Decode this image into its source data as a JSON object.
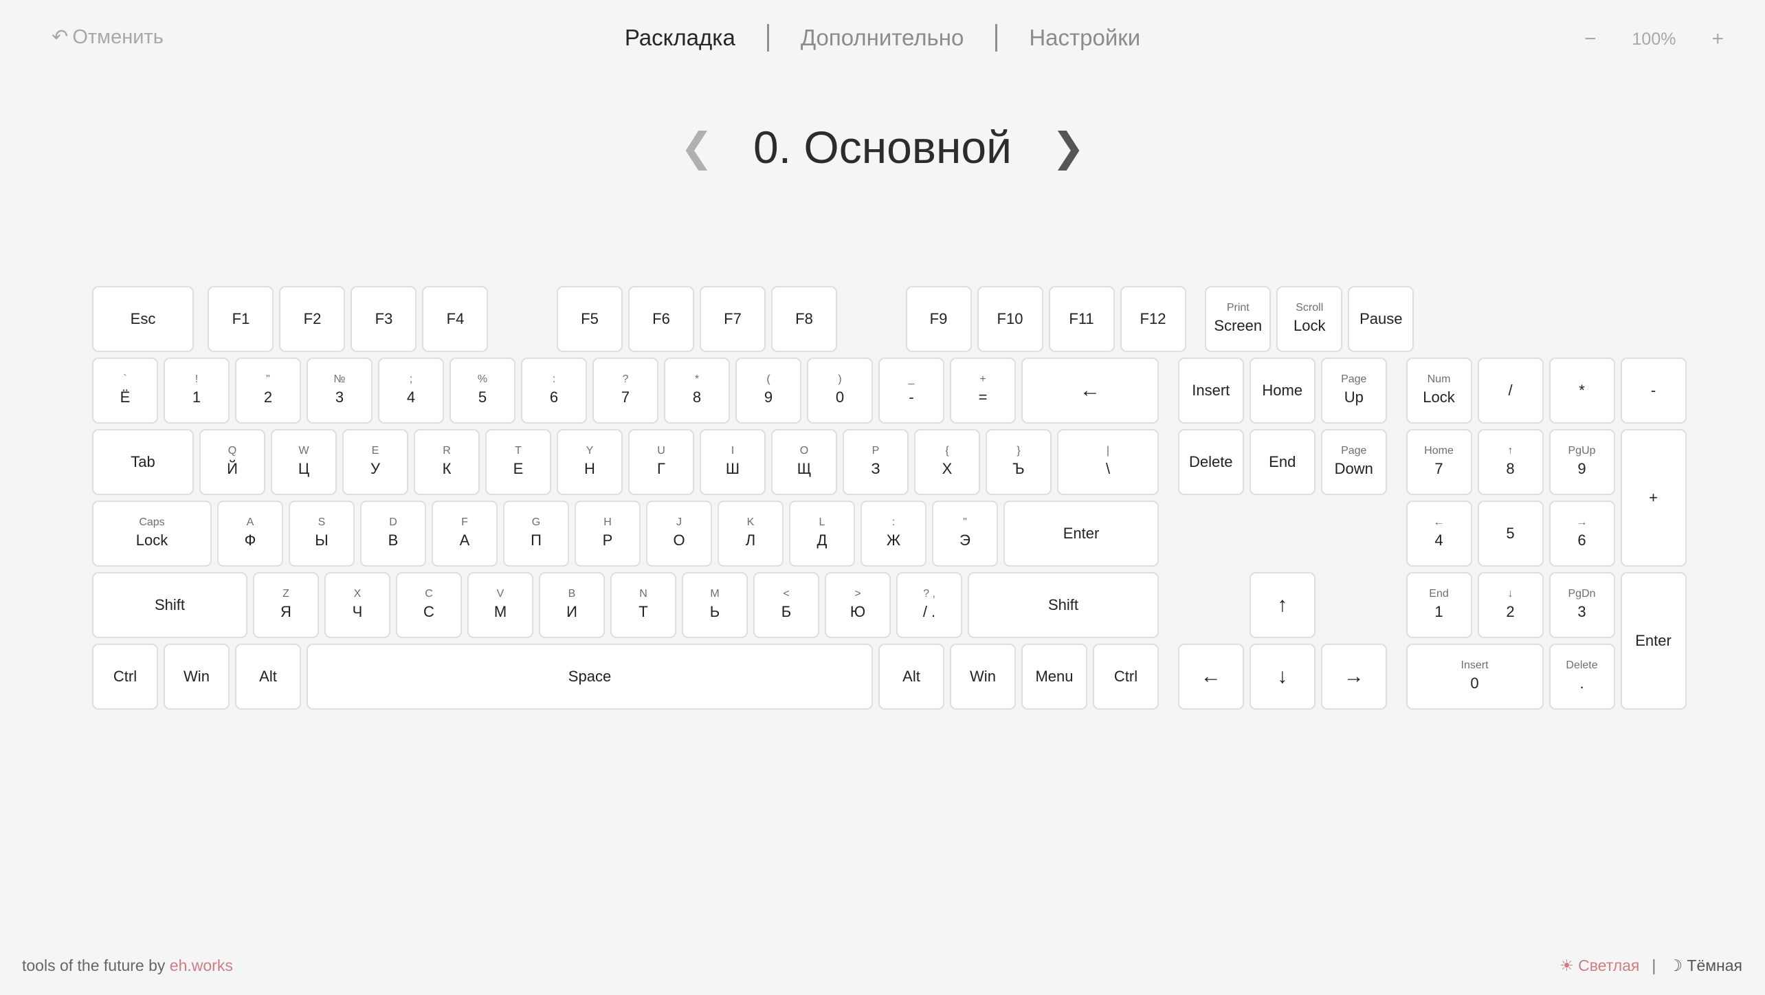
{
  "header": {
    "undo_label": "Отменить",
    "undo_icon": "undo-arrow-icon",
    "tabs": [
      "Раскладка",
      "Дополнительно",
      "Настройки"
    ],
    "active_tab": "Раскладка",
    "zoom": {
      "minus": "−",
      "value": "100%",
      "plus": "+"
    }
  },
  "layer": {
    "title": "0. Основной",
    "prev": "❮",
    "next": "❯"
  },
  "keys": {
    "esc": {
      "sec": "",
      "pri": "Esc"
    },
    "f1": {
      "sec": "",
      "pri": "F1"
    },
    "f2": {
      "sec": "",
      "pri": "F2"
    },
    "f3": {
      "sec": "",
      "pri": "F3"
    },
    "f4": {
      "sec": "",
      "pri": "F4"
    },
    "f5": {
      "sec": "",
      "pri": "F5"
    },
    "f6": {
      "sec": "",
      "pri": "F6"
    },
    "f7": {
      "sec": "",
      "pri": "F7"
    },
    "f8": {
      "sec": "",
      "pri": "F8"
    },
    "f9": {
      "sec": "",
      "pri": "F9"
    },
    "f10": {
      "sec": "",
      "pri": "F10"
    },
    "f11": {
      "sec": "",
      "pri": "F11"
    },
    "f12": {
      "sec": "",
      "pri": "F12"
    },
    "printscreen": {
      "sec": "Print",
      "pri": "Screen"
    },
    "scrolllock": {
      "sec": "Scroll",
      "pri": "Lock"
    },
    "pause": {
      "sec": "",
      "pri": "Pause"
    },
    "grave": {
      "sec": "`",
      "pri": "Ё"
    },
    "d1": {
      "sec": "!",
      "pri": "1"
    },
    "d2": {
      "sec": "\"",
      "pri": "2"
    },
    "d3": {
      "sec": "№",
      "pri": "3"
    },
    "d4": {
      "sec": ";",
      "pri": "4"
    },
    "d5": {
      "sec": "%",
      "pri": "5"
    },
    "d6": {
      "sec": ":",
      "pri": "6"
    },
    "d7": {
      "sec": "?",
      "pri": "7"
    },
    "d8": {
      "sec": "*",
      "pri": "8"
    },
    "d9": {
      "sec": "(",
      "pri": "9"
    },
    "d0": {
      "sec": ")",
      "pri": "0"
    },
    "minus": {
      "sec": "_",
      "pri": "-"
    },
    "equal": {
      "sec": "+",
      "pri": "="
    },
    "backspace": {
      "sec": "",
      "pri": "←"
    },
    "insert": {
      "sec": "",
      "pri": "Insert"
    },
    "home": {
      "sec": "",
      "pri": "Home"
    },
    "pageup": {
      "sec": "Page",
      "pri": "Up"
    },
    "numlock": {
      "sec": "Num",
      "pri": "Lock"
    },
    "kpslash": {
      "sec": "",
      "pri": "/"
    },
    "kpstar": {
      "sec": "",
      "pri": "*"
    },
    "kpminus": {
      "sec": "",
      "pri": "-"
    },
    "tab": {
      "sec": "",
      "pri": "Tab"
    },
    "q": {
      "sec": "Q",
      "pri": "Й"
    },
    "w": {
      "sec": "W",
      "pri": "Ц"
    },
    "e": {
      "sec": "E",
      "pri": "У"
    },
    "r": {
      "sec": "R",
      "pri": "К"
    },
    "t": {
      "sec": "T",
      "pri": "Е"
    },
    "y": {
      "sec": "Y",
      "pri": "Н"
    },
    "u": {
      "sec": "U",
      "pri": "Г"
    },
    "i": {
      "sec": "I",
      "pri": "Ш"
    },
    "o": {
      "sec": "O",
      "pri": "Щ"
    },
    "p": {
      "sec": "P",
      "pri": "З"
    },
    "lbracket": {
      "sec": "{",
      "pri": "Х"
    },
    "rbracket": {
      "sec": "}",
      "pri": "Ъ"
    },
    "backslash": {
      "sec": "|",
      "pri": "\\"
    },
    "delete": {
      "sec": "",
      "pri": "Delete"
    },
    "end": {
      "sec": "",
      "pri": "End"
    },
    "pagedown": {
      "sec": "Page",
      "pri": "Down"
    },
    "kp7": {
      "sec": "Home",
      "pri": "7"
    },
    "kp8": {
      "sec": "↑",
      "pri": "8"
    },
    "kp9": {
      "sec": "PgUp",
      "pri": "9"
    },
    "kpplus": {
      "sec": "",
      "pri": "+"
    },
    "capslock": {
      "sec": "Caps",
      "pri": "Lock"
    },
    "a": {
      "sec": "A",
      "pri": "Ф"
    },
    "s": {
      "sec": "S",
      "pri": "Ы"
    },
    "d": {
      "sec": "D",
      "pri": "В"
    },
    "f": {
      "sec": "F",
      "pri": "А"
    },
    "g": {
      "sec": "G",
      "pri": "П"
    },
    "h": {
      "sec": "H",
      "pri": "Р"
    },
    "j": {
      "sec": "J",
      "pri": "О"
    },
    "k": {
      "sec": "K",
      "pri": "Л"
    },
    "l": {
      "sec": "L",
      "pri": "Д"
    },
    "semicolon": {
      "sec": ":",
      "pri": "Ж"
    },
    "quote": {
      "sec": "\"",
      "pri": "Э"
    },
    "enter": {
      "sec": "",
      "pri": "Enter"
    },
    "kp4": {
      "sec": "←",
      "pri": "4"
    },
    "kp5": {
      "sec": "",
      "pri": "5"
    },
    "kp6": {
      "sec": "→",
      "pri": "6"
    },
    "lshift": {
      "sec": "",
      "pri": "Shift"
    },
    "z": {
      "sec": "Z",
      "pri": "Я"
    },
    "x": {
      "sec": "X",
      "pri": "Ч"
    },
    "c": {
      "sec": "C",
      "pri": "С"
    },
    "v": {
      "sec": "V",
      "pri": "М"
    },
    "b": {
      "sec": "B",
      "pri": "И"
    },
    "n": {
      "sec": "N",
      "pri": "Т"
    },
    "m": {
      "sec": "M",
      "pri": "Ь"
    },
    "comma": {
      "sec": "<",
      "pri": "Б"
    },
    "period": {
      "sec": ">",
      "pri": "Ю"
    },
    "slash": {
      "sec": "?   ,",
      "pri": "/   ."
    },
    "rshift": {
      "sec": "",
      "pri": "Shift"
    },
    "up": {
      "sec": "",
      "pri": "↑"
    },
    "kp1": {
      "sec": "End",
      "pri": "1"
    },
    "kp2": {
      "sec": "↓",
      "pri": "2"
    },
    "kp3": {
      "sec": "PgDn",
      "pri": "3"
    },
    "kpenter": {
      "sec": "",
      "pri": "Enter"
    },
    "lctrl": {
      "sec": "",
      "pri": "Ctrl"
    },
    "lwin": {
      "sec": "",
      "pri": "Win"
    },
    "lalt": {
      "sec": "",
      "pri": "Alt"
    },
    "space": {
      "sec": "",
      "pri": "Space"
    },
    "ralt": {
      "sec": "",
      "pri": "Alt"
    },
    "rwin": {
      "sec": "",
      "pri": "Win"
    },
    "menu": {
      "sec": "",
      "pri": "Menu"
    },
    "rctrl": {
      "sec": "",
      "pri": "Ctrl"
    },
    "left": {
      "sec": "",
      "pri": "←"
    },
    "down": {
      "sec": "",
      "pri": "↓"
    },
    "right": {
      "sec": "",
      "pri": "→"
    },
    "kp0": {
      "sec": "Insert",
      "pri": "0"
    },
    "kpdot": {
      "sec": "Delete",
      "pri": "."
    }
  },
  "footer": {
    "tagline": "tools of the future by",
    "brand": "eh.works",
    "theme_light": "Светлая",
    "theme_separator": "|",
    "theme_dark": "Тёмная",
    "active_theme": "Светлая",
    "light_icon": "sun-icon",
    "dark_icon": "moon-icon",
    "accent_color": "#c97f86"
  }
}
